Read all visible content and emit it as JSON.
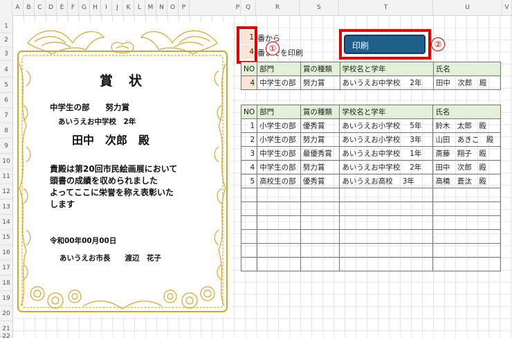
{
  "columns": [
    "A",
    "B",
    "C",
    "D",
    "E",
    "F",
    "G",
    "H",
    "I",
    "J",
    "K",
    "L",
    "M",
    "N",
    "O",
    "P",
    "Q",
    "R",
    "S",
    "T",
    "U",
    "V"
  ],
  "rows": [
    "1",
    "2",
    "3",
    "4",
    "5",
    "6",
    "7",
    "8",
    "9",
    "10",
    "11",
    "12",
    "13",
    "14",
    "15",
    "16",
    "17",
    "18",
    "19",
    "20",
    "21",
    "22"
  ],
  "certificate": {
    "title": "賞　状",
    "division_award": "中学生の部　　努力賞",
    "school": "あいうえお中学校　2年",
    "recipient": "田中　次郎　殿",
    "body": [
      "貴殿は第20回市民絵画展において",
      "頭書の成績を収められました",
      "よってここに栄誉を称え表彰いた",
      "します"
    ],
    "date": "令和00年00月00日",
    "signer": "あいうえお市長　　渡辺　花子"
  },
  "controls": {
    "from_value": "1",
    "from_label": "番から",
    "to_value": "4",
    "to_label": "番までを印刷",
    "print_button": "印刷",
    "marker1": "①",
    "marker2": "②"
  },
  "headers": [
    "NO",
    "部門",
    "賞の種類",
    "学校名と学年",
    "氏名"
  ],
  "selected": {
    "no": "4",
    "dept": "中学生の部",
    "award": "努力賞",
    "school": "あいうえお中学校　 2年",
    "name": "田中　次郎　殿"
  },
  "list": [
    {
      "no": "1",
      "dept": "小学生の部",
      "award": "優秀賞",
      "school": "あいうえお小学校　 5年",
      "name": "鈴木　太郎　殿"
    },
    {
      "no": "2",
      "dept": "小学生の部",
      "award": "努力賞",
      "school": "あいうえお小学校　 3年",
      "name": "山田　あきこ　殿"
    },
    {
      "no": "3",
      "dept": "中学生の部",
      "award": "最優秀賞",
      "school": "あいうえお中学校　 1年",
      "name": "斎藤　翔子　殿"
    },
    {
      "no": "4",
      "dept": "中学生の部",
      "award": "努力賞",
      "school": "あいうえお中学校　 2年",
      "name": "田中　次郎　殿"
    },
    {
      "no": "5",
      "dept": "高校生の部",
      "award": "優秀賞",
      "school": "あいうえお高校　 3年",
      "name": "高橋　蒼汰　殿"
    }
  ],
  "colors": {
    "frame_gold": "#d4a72c",
    "header_green": "#e2efd9",
    "input_peach": "#fbe3d6",
    "button_blue": "#1f5f8b",
    "callout_red": "#e00000"
  }
}
